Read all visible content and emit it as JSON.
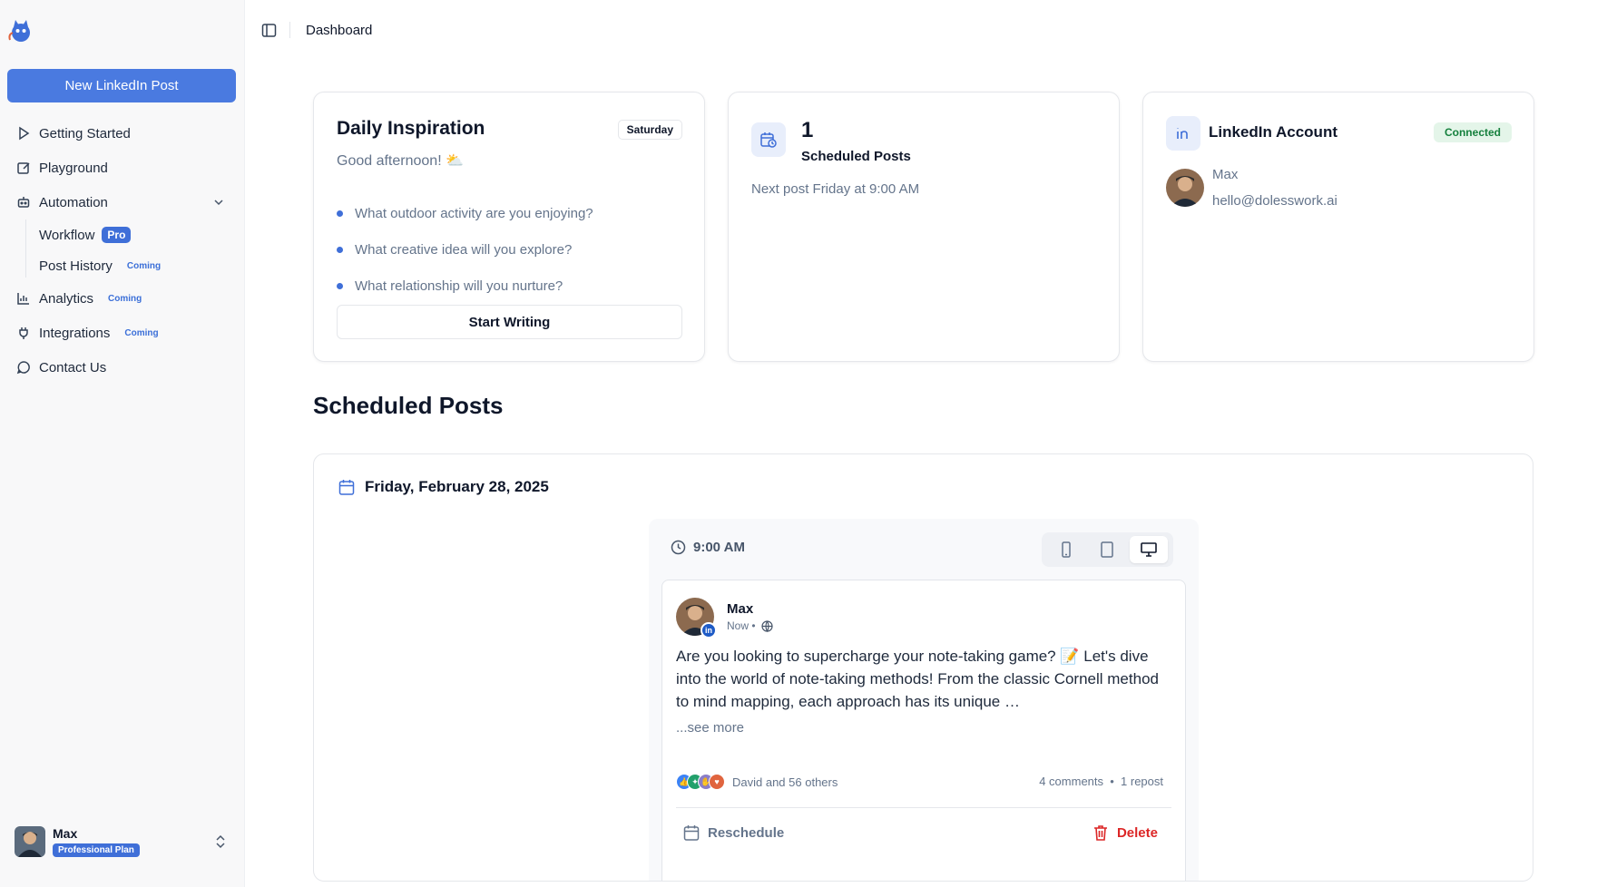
{
  "sidebar": {
    "logo": "cat-logo-icon",
    "new_post_label": "New LinkedIn Post",
    "items": [
      {
        "label": "Getting Started",
        "icon": "play-icon"
      },
      {
        "label": "Playground",
        "icon": "edit-icon"
      },
      {
        "label": "Automation",
        "icon": "bot-icon"
      },
      {
        "label": "Workflow",
        "badge": "Pro"
      },
      {
        "label": "Post History",
        "badge": "Coming"
      },
      {
        "label": "Analytics",
        "icon": "bar-chart-icon",
        "badge": "Coming"
      },
      {
        "label": "Integrations",
        "icon": "plug-icon",
        "badge": "Coming"
      },
      {
        "label": "Contact Us",
        "icon": "chat-icon"
      }
    ],
    "user": {
      "name": "Max",
      "plan": "Professional Plan"
    }
  },
  "topbar": {
    "breadcrumb": "Dashboard"
  },
  "inspiration": {
    "title": "Daily Inspiration",
    "day": "Saturday",
    "greeting": "Good afternoon! ⛅",
    "prompts": [
      "What outdoor activity are you enjoying?",
      "What creative idea will you explore?",
      "What relationship will you nurture?"
    ],
    "button": "Start Writing"
  },
  "scheduled_summary": {
    "count": "1",
    "label": "Scheduled Posts",
    "next": "Next post Friday at 9:00 AM"
  },
  "account": {
    "title": "LinkedIn Account",
    "status": "Connected",
    "name": "Max",
    "email": "hello@dolesswork.ai"
  },
  "scheduled": {
    "section_title": "Scheduled Posts",
    "date": "Friday, February 28, 2025",
    "time": "9:00 AM",
    "post": {
      "author": "Max",
      "meta": "Now •",
      "body": "Are you looking to supercharge your note-taking game? 📝 Let's dive into the world of note-taking methods! From the classic Cornell method to mind mapping, each approach has its unique …",
      "see_more": "...see more",
      "reactions_text": "David and 56 others",
      "stats": "4 comments  •  1 repost",
      "reschedule": "Reschedule",
      "delete": "Delete"
    }
  },
  "colors": {
    "accent": "#4a7ae0",
    "badge": "#3f6fd8",
    "connected_bg": "#e4f5e9",
    "connected_fg": "#15803d",
    "danger": "#dc2626"
  }
}
